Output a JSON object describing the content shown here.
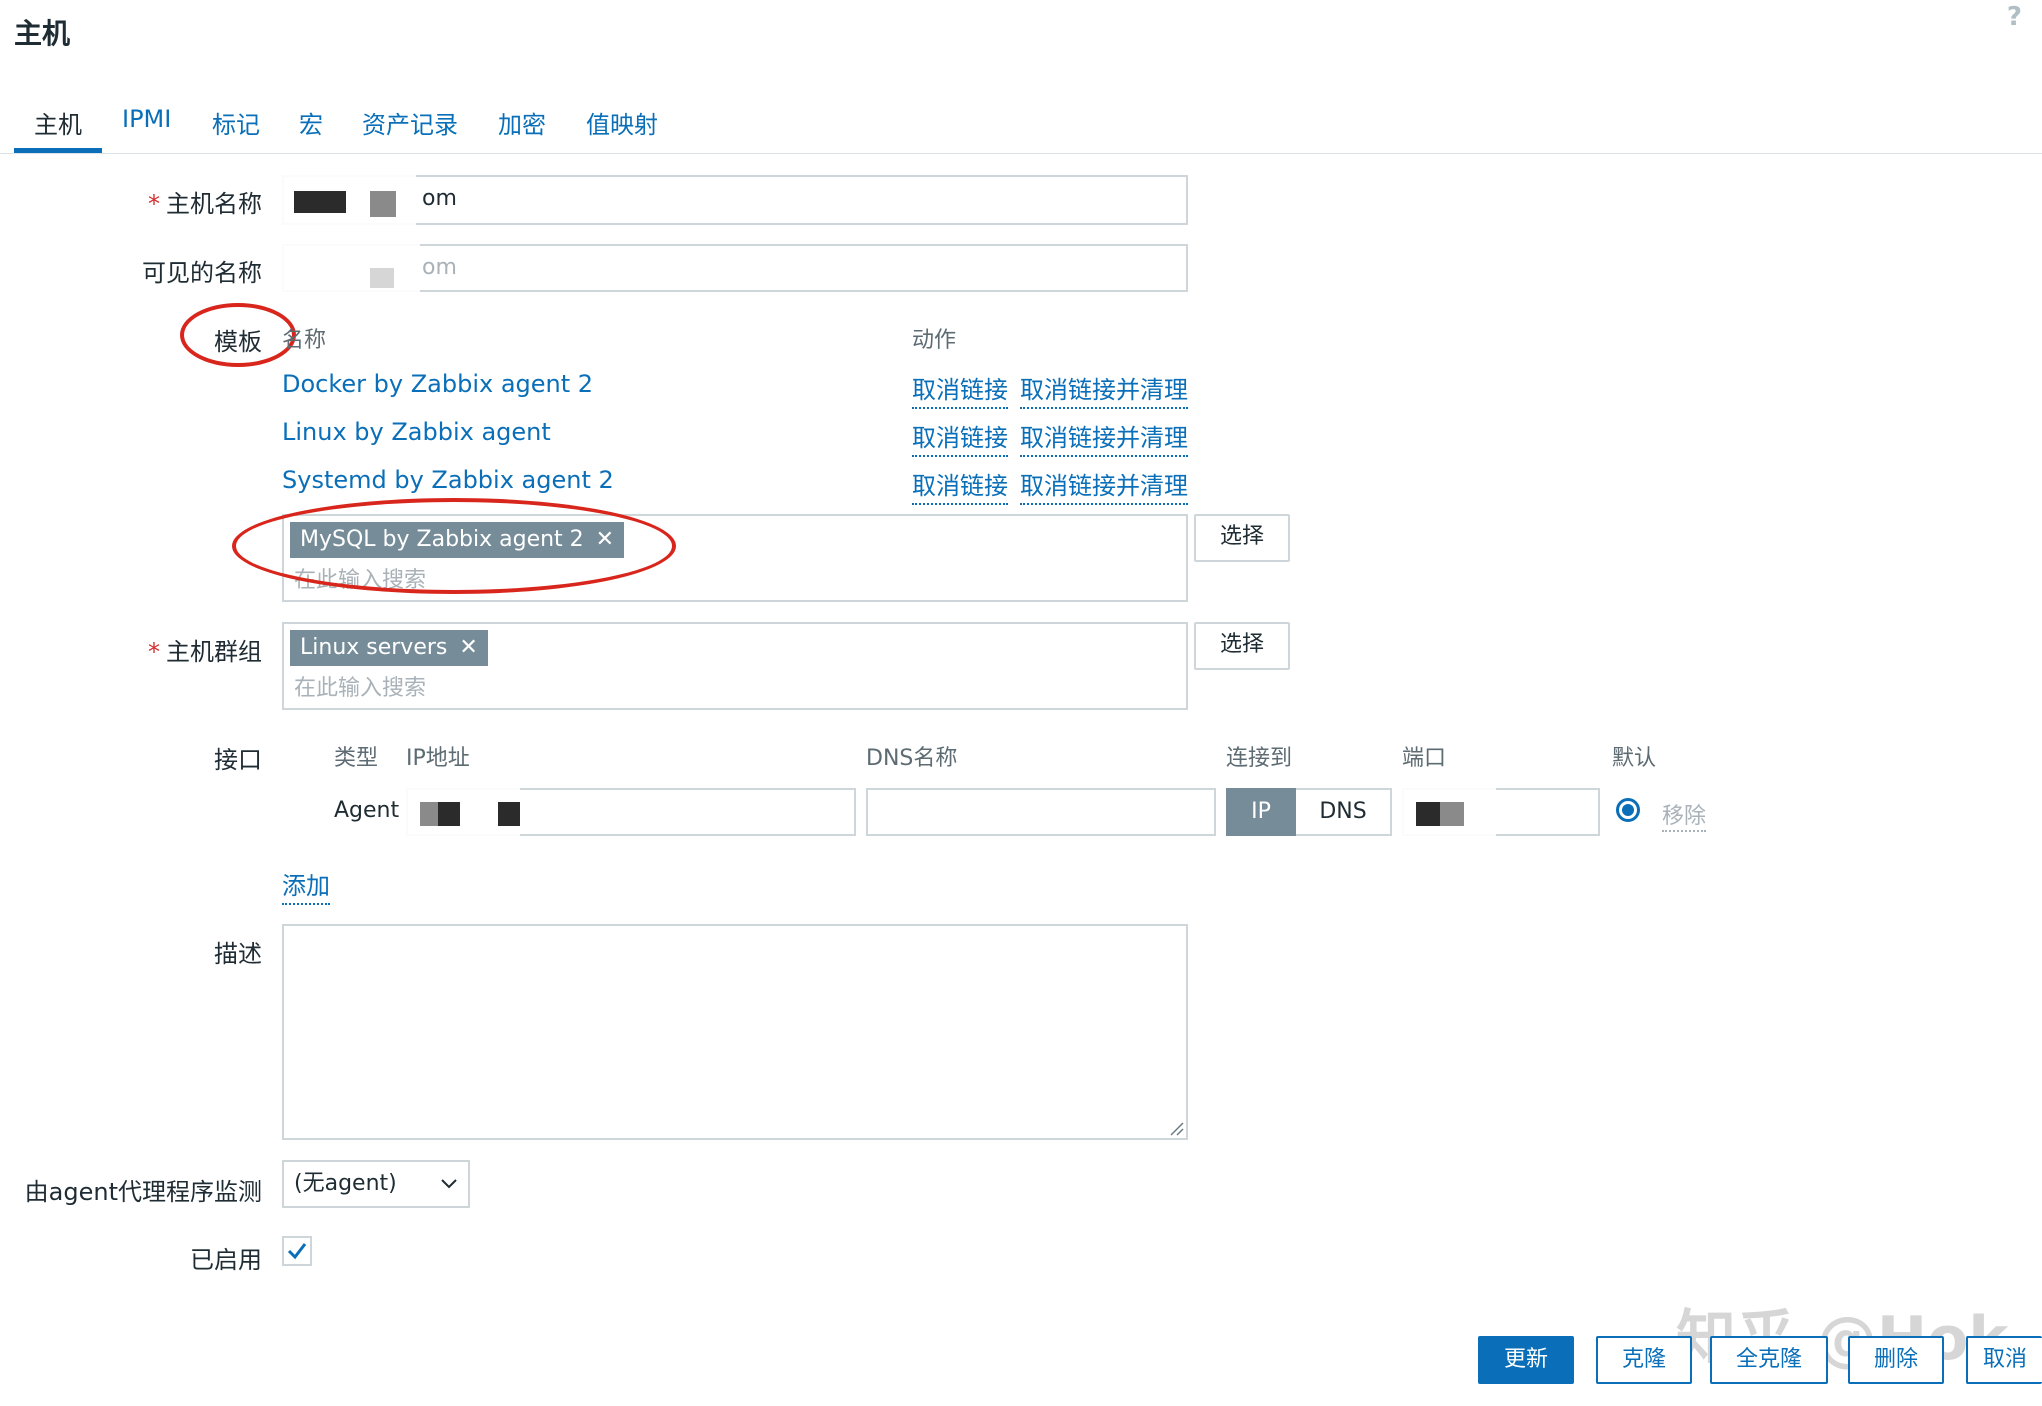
{
  "header": {
    "title": "主机",
    "help": "?"
  },
  "tabs": [
    "主机",
    "IPMI",
    "标记",
    "宏",
    "资产记录",
    "加密",
    "值映射"
  ],
  "form": {
    "host_name": {
      "label": "主机名称",
      "required": "*",
      "value_suffix": "om"
    },
    "visible_name": {
      "label": "可见的名称",
      "placeholder_suffix": "om"
    },
    "templates": {
      "label": "模板",
      "col_name": "名称",
      "col_action": "动作",
      "rows": [
        {
          "name": "Docker by Zabbix agent 2",
          "unlink": "取消链接",
          "unlink_clear": "取消链接并清理"
        },
        {
          "name": "Linux by Zabbix agent",
          "unlink": "取消链接",
          "unlink_clear": "取消链接并清理"
        },
        {
          "name": "Systemd by Zabbix agent 2",
          "unlink": "取消链接",
          "unlink_clear": "取消链接并清理"
        }
      ],
      "chip": "MySQL by Zabbix agent 2",
      "chip_remove": "✕",
      "search_placeholder": "在此输入搜索",
      "select_button": "选择"
    },
    "host_groups": {
      "label": "主机群组",
      "required": "*",
      "chip": "Linux servers",
      "chip_remove": "✕",
      "search_placeholder": "在此输入搜索",
      "select_button": "选择"
    },
    "interfaces": {
      "label": "接口",
      "headers": {
        "type": "类型",
        "ip": "IP地址",
        "dns": "DNS名称",
        "connect": "连接到",
        "port": "端口",
        "default": "默认"
      },
      "row": {
        "type": "Agent",
        "connect_ip": "IP",
        "connect_dns": "DNS",
        "remove": "移除"
      },
      "add": "添加"
    },
    "description": {
      "label": "描述"
    },
    "monitored_by": {
      "label": "由agent代理程序监测",
      "value": "(无agent)"
    },
    "enabled": {
      "label": "已启用",
      "checked": true
    }
  },
  "footer": {
    "update": "更新",
    "clone": "克隆",
    "full_clone": "全克隆",
    "delete": "删除",
    "cancel": "取消"
  },
  "watermark": "知乎 @Hok",
  "colors": {
    "link": "#0a6fb8",
    "chip": "#768d99",
    "annotation": "#d9261c"
  }
}
